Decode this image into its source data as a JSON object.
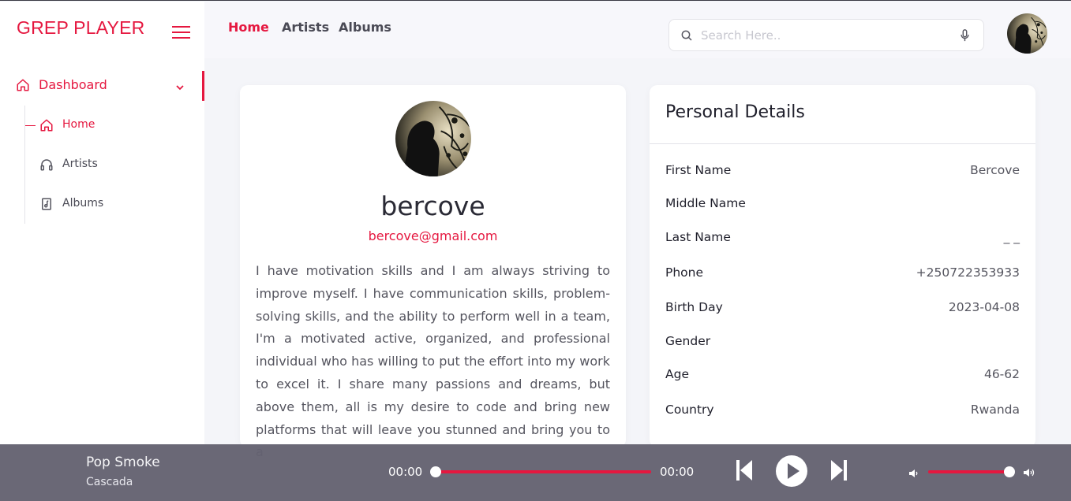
{
  "brand": "GREP PLAYER",
  "sidebar": {
    "dashboard_label": "Dashboard",
    "items": [
      {
        "label": "Home",
        "icon": "home-icon",
        "active": true
      },
      {
        "label": "Artists",
        "icon": "headphones-icon",
        "active": false
      },
      {
        "label": "Albums",
        "icon": "music-file-icon",
        "active": false
      }
    ]
  },
  "topnav": {
    "links": [
      {
        "label": "Home",
        "active": true
      },
      {
        "label": "Artists",
        "active": false
      },
      {
        "label": "Albums",
        "active": false
      }
    ]
  },
  "search": {
    "placeholder": "Search Here..",
    "value": ""
  },
  "profile": {
    "name": "bercove",
    "email": "bercove@gmail.com",
    "bio": "I have motivation skills and I am always striving to improve myself. I have communication skills, problem-solving skills, and the ability to perform well in a team, I'm a motivated active, organized, and professional individual who has willing to put the effort into my work to excel it. I share many passions and dreams, but above them, all is my desire to code and bring new platforms that will leave you stunned and bring you to a"
  },
  "details": {
    "title": "Personal Details",
    "rows": [
      {
        "key": "First Name",
        "value": "Bercove"
      },
      {
        "key": "Middle Name",
        "value": ""
      },
      {
        "key": "Last Name",
        "value": "_ _"
      },
      {
        "key": "Phone",
        "value": "+250722353933"
      },
      {
        "key": "Birth Day",
        "value": "2023-04-08"
      },
      {
        "key": "Gender",
        "value": ""
      },
      {
        "key": "Age",
        "value": "46-62"
      },
      {
        "key": "Country",
        "value": "Rwanda"
      }
    ]
  },
  "player": {
    "track_title": "Pop Smoke",
    "track_artist": "Cascada",
    "current_time": "00:00",
    "total_time": "00:00",
    "progress": 0,
    "volume": 1.0
  },
  "colors": {
    "accent": "#e5173f",
    "player_bg": "#646270",
    "page_bg": "#f4f5f9"
  }
}
